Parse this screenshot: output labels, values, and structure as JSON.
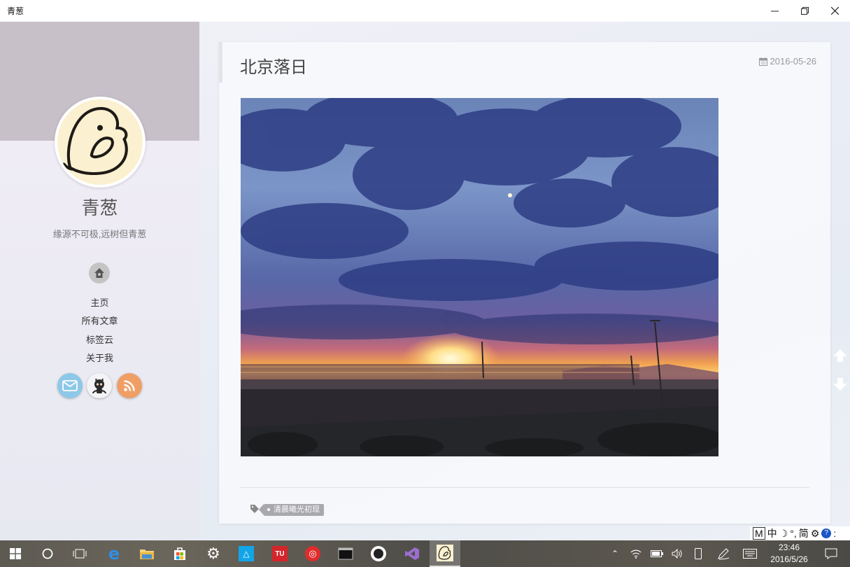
{
  "window": {
    "title": "青葱"
  },
  "sidebar": {
    "name": "青葱",
    "motto": "缘源不可极,远树但青葱",
    "nav": [
      {
        "label": "主页"
      },
      {
        "label": "所有文章"
      },
      {
        "label": "标签云"
      },
      {
        "label": "关于我"
      }
    ],
    "social": [
      "mail-icon",
      "github-icon",
      "rss-icon"
    ]
  },
  "post": {
    "title": "北京落日",
    "date": "2016-05-26",
    "tags": [
      "清晨曦光初现"
    ]
  },
  "ime": {
    "items": [
      "M",
      "中",
      "☽",
      "°,",
      "简",
      "⚙",
      "?",
      ":"
    ]
  },
  "taskbar": {
    "clock_time": "23:46",
    "clock_date": "2016/5/26"
  },
  "colors": {
    "cover": "#c8c0c9",
    "mail": "#8dc8e8",
    "rss": "#ef9f66",
    "tag": "#a8a8ad"
  }
}
